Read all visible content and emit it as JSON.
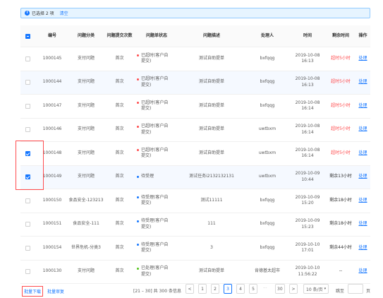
{
  "alert": {
    "icon": "info-icon",
    "text": "已选择 2 项",
    "clear": "清空"
  },
  "columns": [
    "编号",
    "问题分类",
    "问题提交次数",
    "问题单状态",
    "问题描述",
    "处理人",
    "时间",
    "剩余时间",
    "操作"
  ],
  "rows": [
    {
      "no": "1000145",
      "cat": "支付问题",
      "times": "首次",
      "status": "已超时(客户自提交)",
      "status_color": "#ff4d4f",
      "desc": "测试自助提单",
      "user": "bxfqqg",
      "time": "2019-10-08 16:13",
      "rem": "超时5小时",
      "rem_color": "red",
      "op": "处理",
      "checked": false
    },
    {
      "no": "1000144",
      "cat": "支付问题",
      "times": "首次",
      "status": "已超时(客户自提交)",
      "status_color": "#ff4d4f",
      "desc": "测试自助提单",
      "user": "bxfqqg",
      "time": "2019-10-08 16:13",
      "rem": "超时5小时",
      "rem_color": "red",
      "op": "处理",
      "checked": false
    },
    {
      "no": "1000147",
      "cat": "支付问题",
      "times": "首次",
      "status": "已超时(客户自提交)",
      "status_color": "#ff4d4f",
      "desc": "测试自助提单",
      "user": "bxfqqg",
      "time": "2019-10-08 16:14",
      "rem": "超时5小时",
      "rem_color": "red",
      "op": "处理",
      "checked": false
    },
    {
      "no": "1000146",
      "cat": "支付问题",
      "times": "首次",
      "status": "已超时(客户自提交)",
      "status_color": "#ff4d4f",
      "desc": "测试自助提单",
      "user": "uwtbxm",
      "time": "2019-10-08 16:14",
      "rem": "超时5小时",
      "rem_color": "red",
      "op": "处理",
      "checked": false
    },
    {
      "no": "1000148",
      "cat": "支付问题",
      "times": "首次",
      "status": "已超时(客户自提交)",
      "status_color": "#ff4d4f",
      "desc": "测试自助提单",
      "user": "uwtbxm",
      "time": "2019-10-08 16:14",
      "rem": "超时5小时",
      "rem_color": "red",
      "op": "处理",
      "checked": true
    },
    {
      "no": "1000149",
      "cat": "支付问题",
      "times": "首次",
      "status": "待受理",
      "status_color": "#1677ff",
      "desc": "测试任务i2132132131",
      "user": "uwtbxm",
      "time": "2019-10-09 10:44",
      "rem": "剩余13小时",
      "rem_color": "dark",
      "op": "处理",
      "checked": true
    },
    {
      "no": "1000150",
      "cat": "食品安全-123213",
      "times": "首次",
      "status": "待受理(客户自提交)",
      "status_color": "#1677ff",
      "desc": "测试11111",
      "user": "bxfqqg",
      "time": "2019-10-09 15:20",
      "rem": "剩余18小时",
      "rem_color": "dark",
      "op": "处理",
      "checked": false
    },
    {
      "no": "1000151",
      "cat": "食品安全-111",
      "times": "首次",
      "status": "待受理(客户自提交)",
      "status_color": "#1677ff",
      "desc": "111",
      "user": "bxfqqg",
      "time": "2019-10-09 15:23",
      "rem": "剩余18小时",
      "rem_color": "dark",
      "op": "处理",
      "checked": false
    },
    {
      "no": "1000154",
      "cat": "世界危机-分类3",
      "times": "首次",
      "status": "待受理(客户自提交)",
      "status_color": "#1677ff",
      "desc": "3",
      "user": "bxfqqg",
      "time": "2019-10-10 17:01",
      "rem": "剩余44小时",
      "rem_color": "dark",
      "op": "处理",
      "checked": false
    },
    {
      "no": "1000130",
      "cat": "支付问题",
      "times": "首次",
      "status": "已处理(客户自提交)",
      "status_color": "#52c41a",
      "desc": "测试自助提单",
      "user": "肯德基太超市",
      "time": "2019-10-10 11:56:22",
      "rem": "--",
      "rem_color": "dark",
      "op": "处理",
      "checked": false
    }
  ],
  "footer": {
    "batch_download": "批量下载",
    "batch_review": "批量审复",
    "range": "[21 – 30] 共 300 条信息",
    "prev": "<",
    "pages": [
      "1",
      "2",
      "3",
      "4",
      "5"
    ],
    "active_page": "3",
    "ellipsis": "···",
    "last_page": "30",
    "next": ">",
    "page_size": "10 条/页",
    "jump_label": "跳至",
    "page_unit": "页"
  }
}
